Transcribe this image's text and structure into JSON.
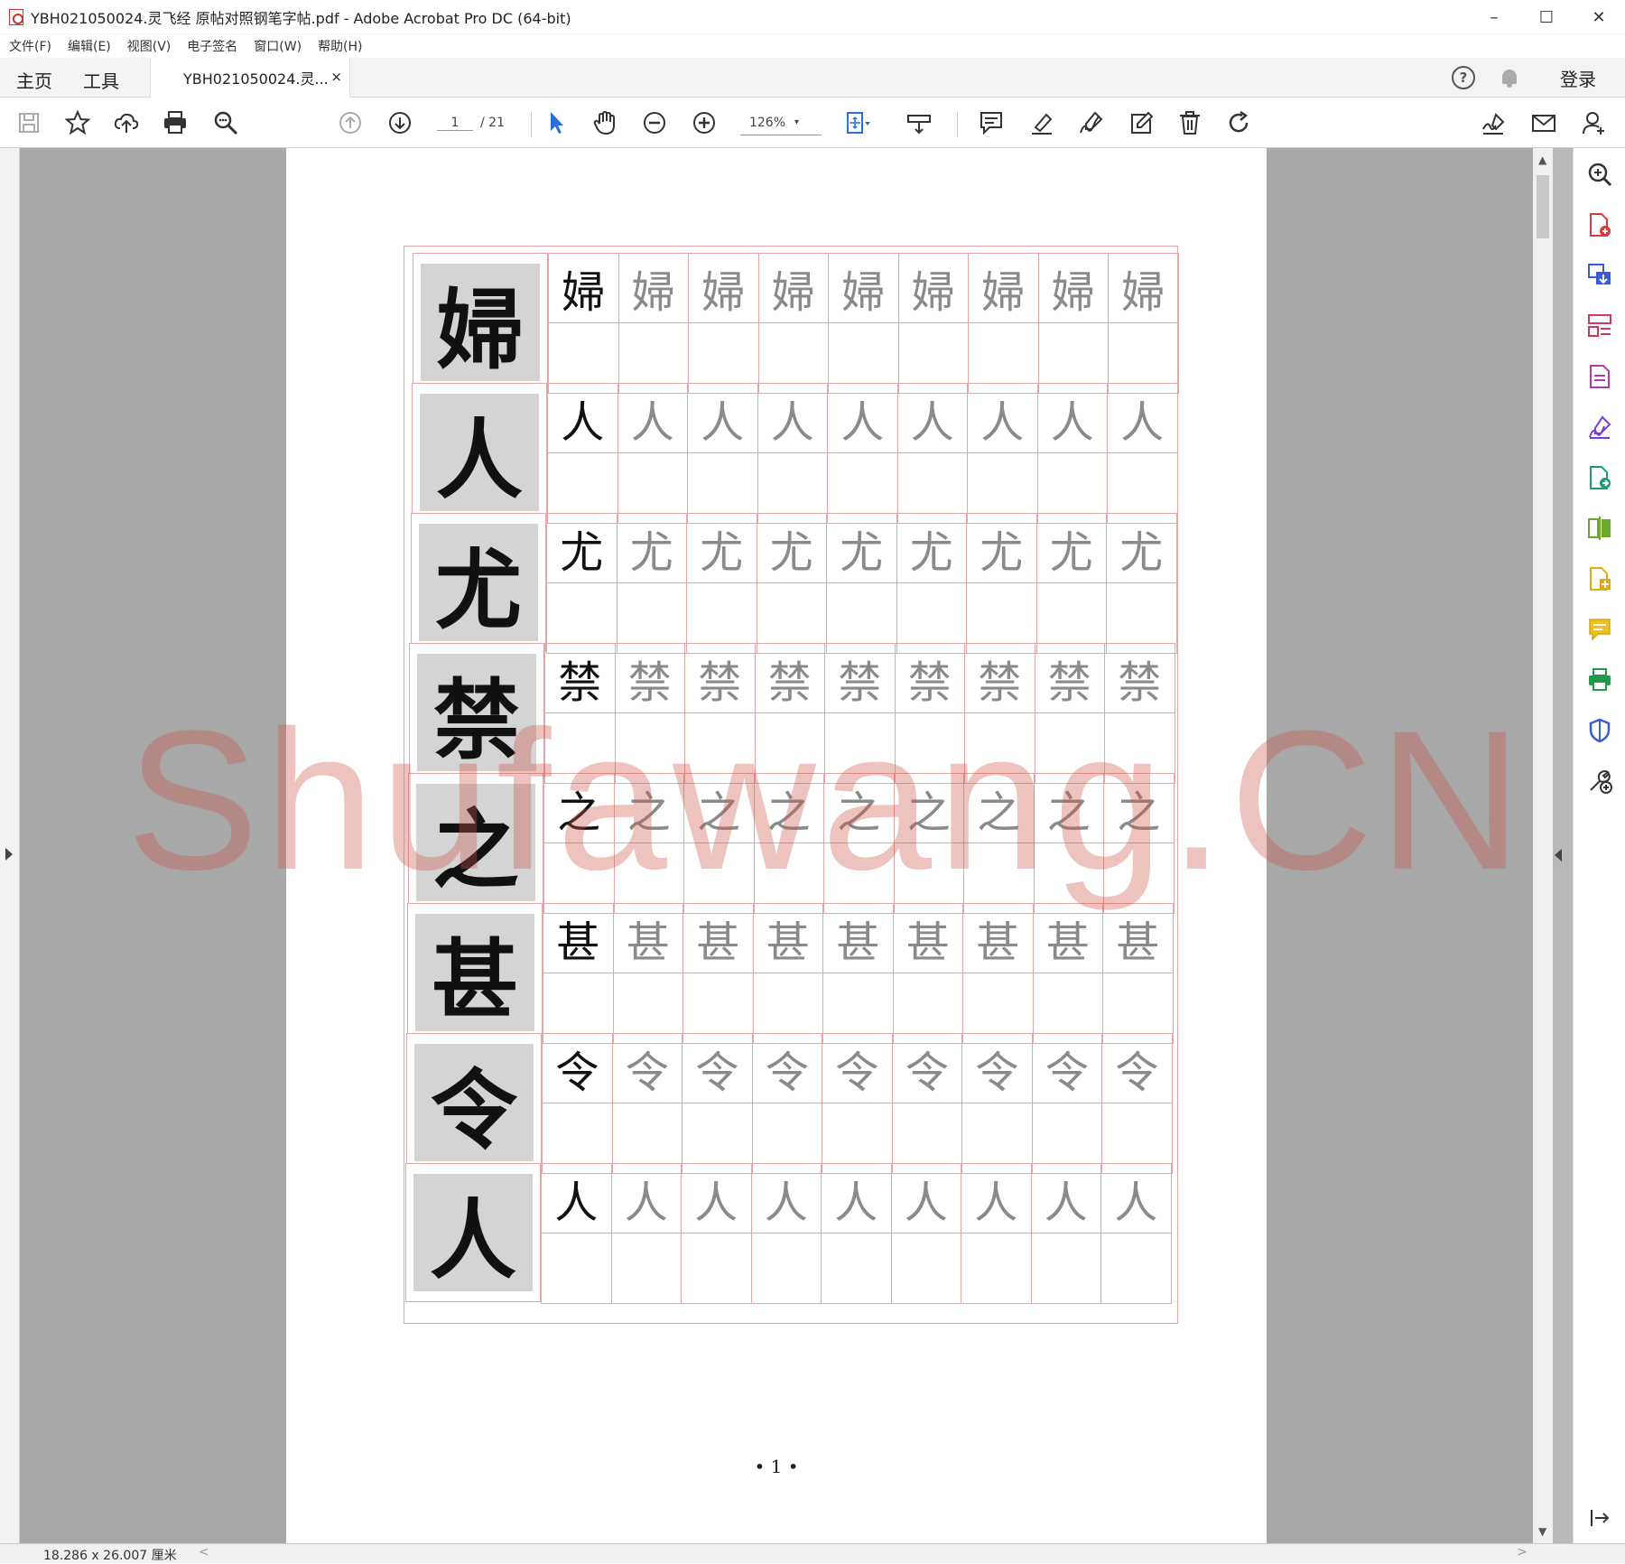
{
  "window": {
    "title": "YBH021050024.灵飞经 原帖对照钢笔字帖.pdf - Adobe Acrobat Pro DC (64-bit)",
    "minimize": "–",
    "maximize": "☐",
    "close": "✕"
  },
  "menu": [
    "文件(F)",
    "编辑(E)",
    "视图(V)",
    "电子签名",
    "窗口(W)",
    "帮助(H)"
  ],
  "tabs": {
    "home": "主页",
    "tools": "工具",
    "document": "YBH021050024.灵...",
    "close": "×"
  },
  "header_right": {
    "help": "?",
    "login": "登录"
  },
  "toolbar": {
    "page_current": "1",
    "page_total": "/ 21",
    "zoom": "126%",
    "zoom_dropdown": "▾"
  },
  "document": {
    "rows": [
      {
        "char": "婦",
        "reps": [
          "婦",
          "婦",
          "婦",
          "婦",
          "婦",
          "婦",
          "婦",
          "婦",
          "婦"
        ]
      },
      {
        "char": "人",
        "reps": [
          "人",
          "人",
          "人",
          "人",
          "人",
          "人",
          "人",
          "人",
          "人"
        ]
      },
      {
        "char": "尤",
        "reps": [
          "尤",
          "尤",
          "尤",
          "尤",
          "尤",
          "尤",
          "尤",
          "尤",
          "尤"
        ]
      },
      {
        "char": "禁",
        "reps": [
          "禁",
          "禁",
          "禁",
          "禁",
          "禁",
          "禁",
          "禁",
          "禁",
          "禁"
        ]
      },
      {
        "char": "之",
        "reps": [
          "之",
          "之",
          "之",
          "之",
          "之",
          "之",
          "之",
          "之",
          "之"
        ]
      },
      {
        "char": "甚",
        "reps": [
          "甚",
          "甚",
          "甚",
          "甚",
          "甚",
          "甚",
          "甚",
          "甚",
          "甚"
        ]
      },
      {
        "char": "令",
        "reps": [
          "令",
          "令",
          "令",
          "令",
          "令",
          "令",
          "令",
          "令",
          "令"
        ]
      },
      {
        "char": "人",
        "reps": [
          "人",
          "人",
          "人",
          "人",
          "人",
          "人",
          "人",
          "人",
          "人"
        ]
      }
    ],
    "page_number": "• 1 •",
    "watermark": "Shufawang.CN"
  },
  "status": {
    "page_size": "18.286 x 26.007 厘米",
    "scroll_left": "<",
    "scroll_right": ">"
  },
  "scrollbar": {
    "up": "▲",
    "down": "▼"
  },
  "colors": {
    "grid_red": "#e3a7a7",
    "first_trace_black": "#111111",
    "trace_gray": "#8a8a8a",
    "watermark": "#cd5046"
  }
}
